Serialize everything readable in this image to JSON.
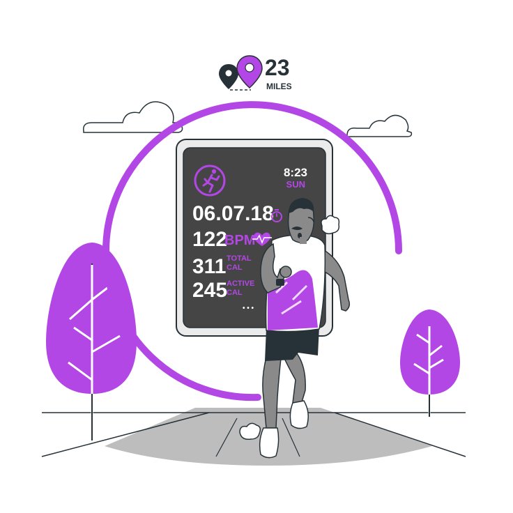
{
  "distance": {
    "value": "23",
    "unit": "MILES"
  },
  "watch": {
    "time": "8:23",
    "day": "SUN",
    "duration": "06.07.18",
    "heart_rate": {
      "value": "122",
      "unit": "BPM"
    },
    "total_cal": {
      "value": "311",
      "label_line1": "TOTAL",
      "label_line2": "CAL"
    },
    "active_cal": {
      "value": "245",
      "label_line1": "ACTIVE",
      "label_line2": "CAL"
    },
    "more": "• • •"
  },
  "colors": {
    "accent": "#B347E5",
    "dark": "#263238",
    "screen": "#454545",
    "bezel": "#EBEBEB",
    "grey": "#8A8A8A",
    "white": "#FFFFFF"
  },
  "icons": [
    "location-pin-icon",
    "runner-icon",
    "stopwatch-icon",
    "heart-rate-icon"
  ]
}
